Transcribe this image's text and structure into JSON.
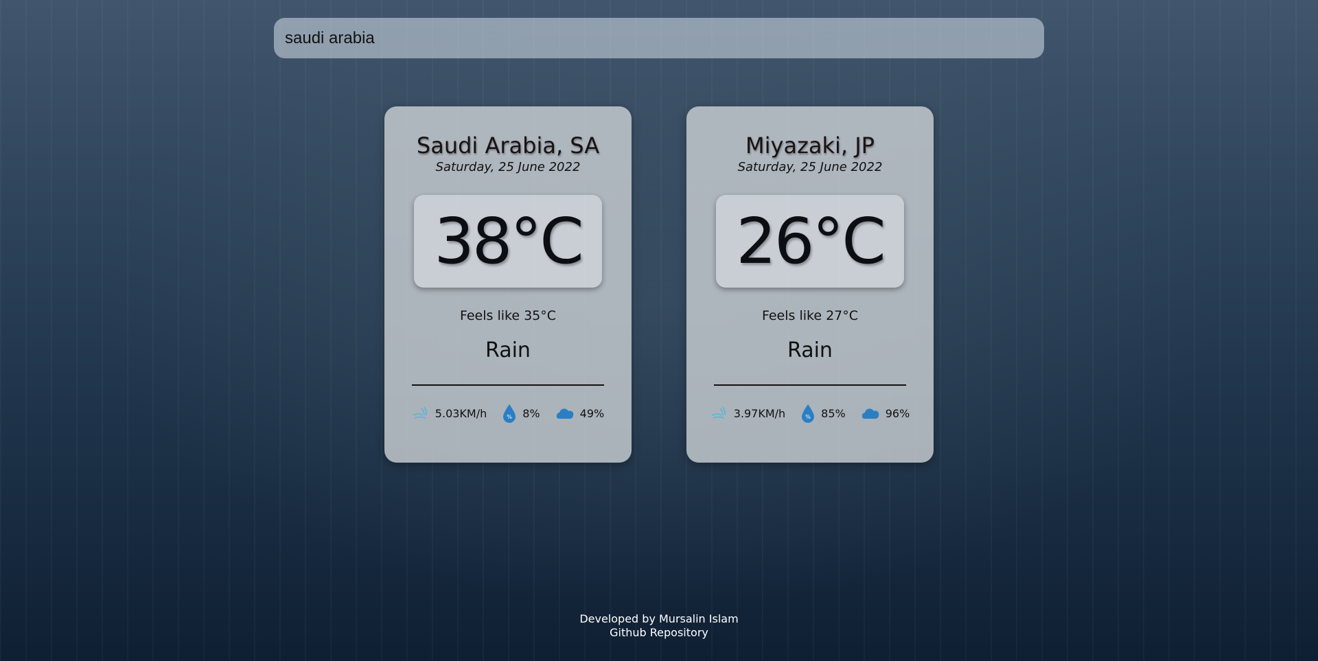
{
  "search": {
    "value": "saudi arabia"
  },
  "cards": [
    {
      "city": "Saudi Arabia, SA",
      "date": "Saturday, 25 June 2022",
      "temp": "38°C",
      "feels": "Feels like 35°C",
      "condition": "Rain",
      "wind": "5.03KM/h",
      "humidity": "8%",
      "clouds": "49%"
    },
    {
      "city": "Miyazaki, JP",
      "date": "Saturday, 25 June 2022",
      "temp": "26°C",
      "feels": "Feels like 27°C",
      "condition": "Rain",
      "wind": "3.97KM/h",
      "humidity": "85%",
      "clouds": "96%"
    }
  ],
  "footer": {
    "credit": "Developed by Mursalin Islam",
    "repo_link": "Github Repository"
  },
  "colors": {
    "icon_blue": "#2a7fc4"
  }
}
